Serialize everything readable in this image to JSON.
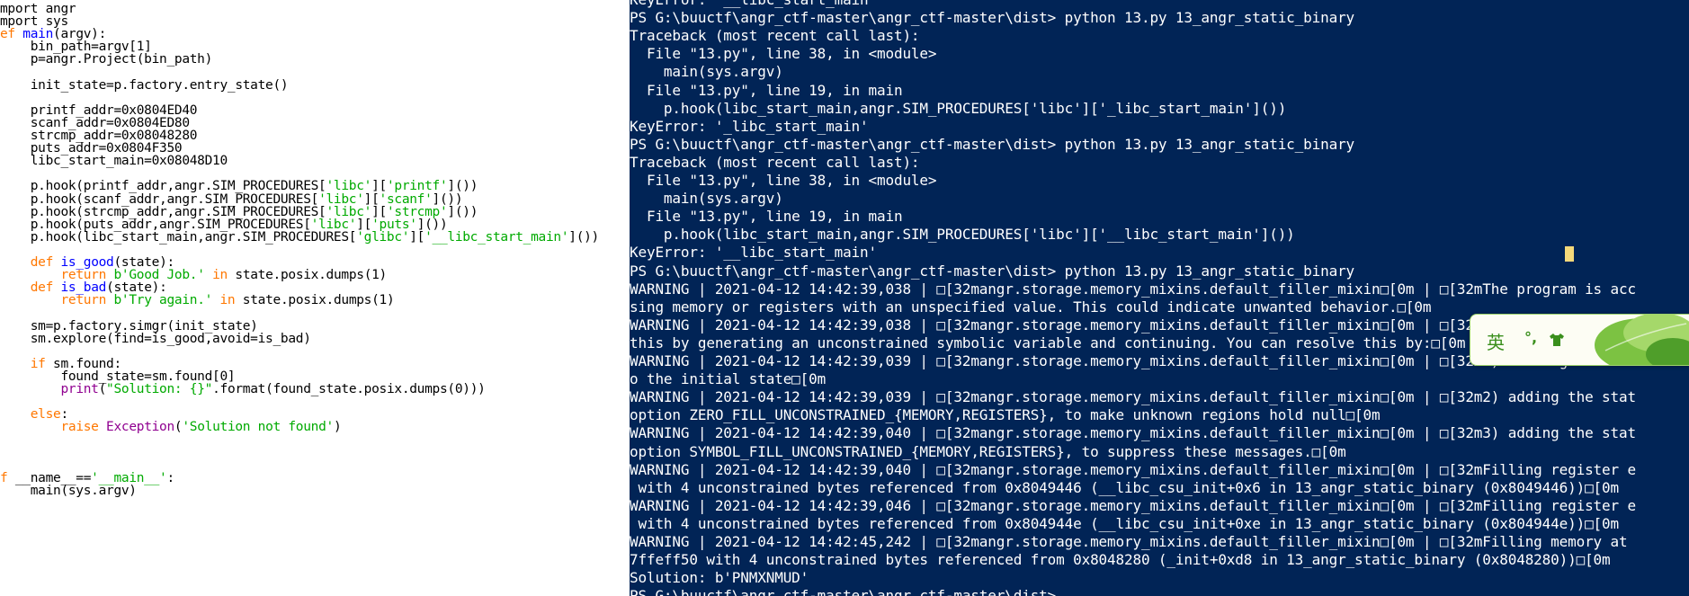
{
  "editor": {
    "lines": [
      [
        {
          "t": "mport angr"
        }
      ],
      [
        {
          "t": "mport sys"
        }
      ],
      [
        {
          "t": "ef ",
          "c": "kw"
        },
        {
          "t": "main",
          "c": "fn"
        },
        {
          "t": "(argv):"
        }
      ],
      [
        {
          "t": "    bin_path=argv[1]"
        }
      ],
      [
        {
          "t": "    p=angr.Project(bin_path)"
        }
      ],
      [],
      [
        {
          "t": "    init_state=p.factory.entry_state()"
        }
      ],
      [],
      [
        {
          "t": "    printf_addr=0x0804ED40"
        }
      ],
      [
        {
          "t": "    scanf_addr=0x0804ED80"
        }
      ],
      [
        {
          "t": "    strcmp_addr=0x08048280"
        }
      ],
      [
        {
          "t": "    puts_addr=0x0804F350"
        }
      ],
      [
        {
          "t": "    libc_start_main=0x08048D10"
        }
      ],
      [],
      [
        {
          "t": "    p.hook(printf_addr,angr.SIM_PROCEDURES["
        },
        {
          "t": "'libc'",
          "c": "str"
        },
        {
          "t": "]["
        },
        {
          "t": "'printf'",
          "c": "str"
        },
        {
          "t": "]())"
        }
      ],
      [
        {
          "t": "    p.hook(scanf_addr,angr.SIM_PROCEDURES["
        },
        {
          "t": "'libc'",
          "c": "str"
        },
        {
          "t": "]["
        },
        {
          "t": "'scanf'",
          "c": "str"
        },
        {
          "t": "]())"
        }
      ],
      [
        {
          "t": "    p.hook(strcmp_addr,angr.SIM_PROCEDURES["
        },
        {
          "t": "'libc'",
          "c": "str"
        },
        {
          "t": "]["
        },
        {
          "t": "'strcmp'",
          "c": "str"
        },
        {
          "t": "]())"
        }
      ],
      [
        {
          "t": "    p.hook(puts_addr,angr.SIM_PROCEDURES["
        },
        {
          "t": "'libc'",
          "c": "str"
        },
        {
          "t": "]["
        },
        {
          "t": "'puts'",
          "c": "str"
        },
        {
          "t": "]())"
        }
      ],
      [
        {
          "t": "    p.hook(libc_start_main,angr.SIM_PROCEDURES["
        },
        {
          "t": "'glibc'",
          "c": "str"
        },
        {
          "t": "]["
        },
        {
          "t": "'__libc_start_main'",
          "c": "str"
        },
        {
          "t": "]())"
        }
      ],
      [],
      [
        {
          "t": "    "
        },
        {
          "t": "def ",
          "c": "kw"
        },
        {
          "t": "is_good",
          "c": "fn"
        },
        {
          "t": "(state):"
        }
      ],
      [
        {
          "t": "        "
        },
        {
          "t": "return ",
          "c": "kw"
        },
        {
          "t": "b'Good Job.'",
          "c": "str"
        },
        {
          "t": " "
        },
        {
          "t": "in",
          "c": "kw"
        },
        {
          "t": " state.posix.dumps(1)"
        }
      ],
      [
        {
          "t": "    "
        },
        {
          "t": "def ",
          "c": "kw"
        },
        {
          "t": "is_bad",
          "c": "fn"
        },
        {
          "t": "(state):"
        }
      ],
      [
        {
          "t": "        "
        },
        {
          "t": "return ",
          "c": "kw"
        },
        {
          "t": "b'Try again.'",
          "c": "str"
        },
        {
          "t": " "
        },
        {
          "t": "in",
          "c": "kw"
        },
        {
          "t": " state.posix.dumps(1)"
        }
      ],
      [],
      [
        {
          "t": "    sm=p.factory.simgr(init_state)"
        }
      ],
      [
        {
          "t": "    sm.explore(find=is_good,avoid=is_bad)"
        }
      ],
      [],
      [
        {
          "t": "    "
        },
        {
          "t": "if",
          "c": "kw"
        },
        {
          "t": " sm.found:"
        }
      ],
      [
        {
          "t": "        found_state=sm.found[0]"
        }
      ],
      [
        {
          "t": "        "
        },
        {
          "t": "print",
          "c": "bi"
        },
        {
          "t": "("
        },
        {
          "t": "\"Solution: {}\"",
          "c": "str"
        },
        {
          "t": ".format(found_state.posix.dumps(0)))"
        }
      ],
      [],
      [
        {
          "t": "    "
        },
        {
          "t": "else",
          "c": "kw"
        },
        {
          "t": ":"
        }
      ],
      [
        {
          "t": "        "
        },
        {
          "t": "raise ",
          "c": "kw"
        },
        {
          "t": "Exception",
          "c": "bi"
        },
        {
          "t": "("
        },
        {
          "t": "'Solution not found'",
          "c": "str"
        },
        {
          "t": ")"
        }
      ],
      [],
      [],
      [],
      [
        {
          "t": "f",
          "c": "kw"
        },
        {
          "t": " __name__=="
        },
        {
          "t": "'__main__'",
          "c": "str"
        },
        {
          "t": ":"
        }
      ],
      [
        {
          "t": "    main(sys.argv)"
        }
      ]
    ]
  },
  "terminal": {
    "lines": [
      "KeyError: '__libc_start_main'",
      "PS G:\\buuctf\\angr_ctf-master\\angr_ctf-master\\dist> python 13.py 13_angr_static_binary",
      "Traceback (most recent call last):",
      "  File \"13.py\", line 38, in <module>",
      "    main(sys.argv)",
      "  File \"13.py\", line 19, in main",
      "    p.hook(libc_start_main,angr.SIM_PROCEDURES['libc']['_libc_start_main']())",
      "KeyError: '_libc_start_main'",
      "PS G:\\buuctf\\angr_ctf-master\\angr_ctf-master\\dist> python 13.py 13_angr_static_binary",
      "Traceback (most recent call last):",
      "  File \"13.py\", line 38, in <module>",
      "    main(sys.argv)",
      "  File \"13.py\", line 19, in main",
      "    p.hook(libc_start_main,angr.SIM_PROCEDURES['libc']['__libc_start_main']())",
      "KeyError: '__libc_start_main'",
      "PS G:\\buuctf\\angr_ctf-master\\angr_ctf-master\\dist> python 13.py 13_angr_static_binary",
      "WARNING | 2021-04-12 14:42:39,038 | □[32mangr.storage.memory_mixins.default_filler_mixin□[0m | □[32mThe program is acc",
      "sing memory or registers with an unspecified value. This could indicate unwanted behavior.□[0m",
      "WARNING | 2021-04-12 14:42:39,038 | □[32mangr.storage.memory_mixins.default_filler_mixin□[0m | □[32mangr will cope with",
      "this by generating an unconstrained symbolic variable and continuing. You can resolve this by:□[0m",
      "WARNING | 2021-04-12 14:42:39,039 | □[32mangr.storage.memory_mixins.default_filler_mixin□[0m | □[32m1) setting a value",
      "o the initial state□[0m",
      "WARNING | 2021-04-12 14:42:39,039 | □[32mangr.storage.memory_mixins.default_filler_mixin□[0m | □[32m2) adding the stat",
      "option ZERO_FILL_UNCONSTRAINED_{MEMORY,REGISTERS}, to make unknown regions hold null□[0m",
      "WARNING | 2021-04-12 14:42:39,040 | □[32mangr.storage.memory_mixins.default_filler_mixin□[0m | □[32m3) adding the stat",
      "option SYMBOL_FILL_UNCONSTRAINED_{MEMORY,REGISTERS}, to suppress these messages.□[0m",
      "WARNING | 2021-04-12 14:42:39,040 | □[32mangr.storage.memory_mixins.default_filler_mixin□[0m | □[32mFilling register e",
      " with 4 unconstrained bytes referenced from 0x8049446 (__libc_csu_init+0x6 in 13_angr_static_binary (0x8049446))□[0m",
      "WARNING | 2021-04-12 14:42:39,046 | □[32mangr.storage.memory_mixins.default_filler_mixin□[0m | □[32mFilling register e",
      " with 4 unconstrained bytes referenced from 0x804944e (__libc_csu_init+0xe in 13_angr_static_binary (0x804944e))□[0m",
      "WARNING | 2021-04-12 14:42:45,242 | □[32mangr.storage.memory_mixins.default_filler_mixin□[0m | □[32mFilling memory at",
      "7ffeff50 with 4 unconstrained bytes referenced from 0x8048280 (_init+0xd8 in 13_angr_static_binary (0x8048280))□[0m",
      "Solution: b'PNMXNMUD'",
      "PS G:\\buuctf\\angr_ctf-master\\angr_ctf-master\\dist>"
    ]
  },
  "ime": {
    "mode_label": "英",
    "punct_label": "°,",
    "icons": [
      "tshirt-icon",
      "leaf-icon"
    ]
  }
}
